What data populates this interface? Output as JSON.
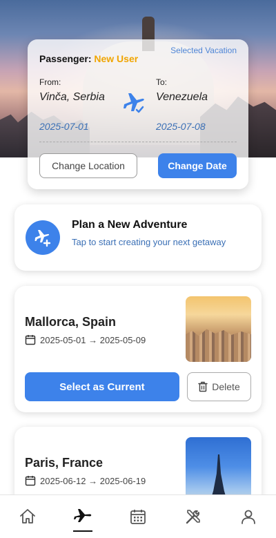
{
  "vacation": {
    "passenger_label": "Passenger:",
    "passenger_name": "New User",
    "selected_label": "Selected Vacation",
    "from_label": "From:",
    "to_label": "To:",
    "from_city": "Vinča, Serbia",
    "to_city": "Venezuela",
    "from_date": "2025-07-01",
    "to_date": "2025-07-08",
    "change_location_label": "Change Location",
    "change_date_label": "Change Date"
  },
  "plan": {
    "title": "Plan a New Adventure",
    "subtitle": "Tap to start creating your next getaway"
  },
  "trips": [
    {
      "title": "Mallorca, Spain",
      "dates": "2025-05-01 → 2025-05-09",
      "select_label": "Select as Current",
      "delete_label": "Delete"
    },
    {
      "title": "Paris, France",
      "dates": "2025-06-12 → 2025-06-19"
    }
  ],
  "nav": {
    "items": [
      "home-icon",
      "plane-icon",
      "calendar-icon",
      "tools-icon",
      "user-icon"
    ],
    "active": "plane-icon"
  },
  "colors": {
    "accent": "#3d82ea",
    "highlight": "#f0a500",
    "date_text": "#3a6fb5"
  }
}
